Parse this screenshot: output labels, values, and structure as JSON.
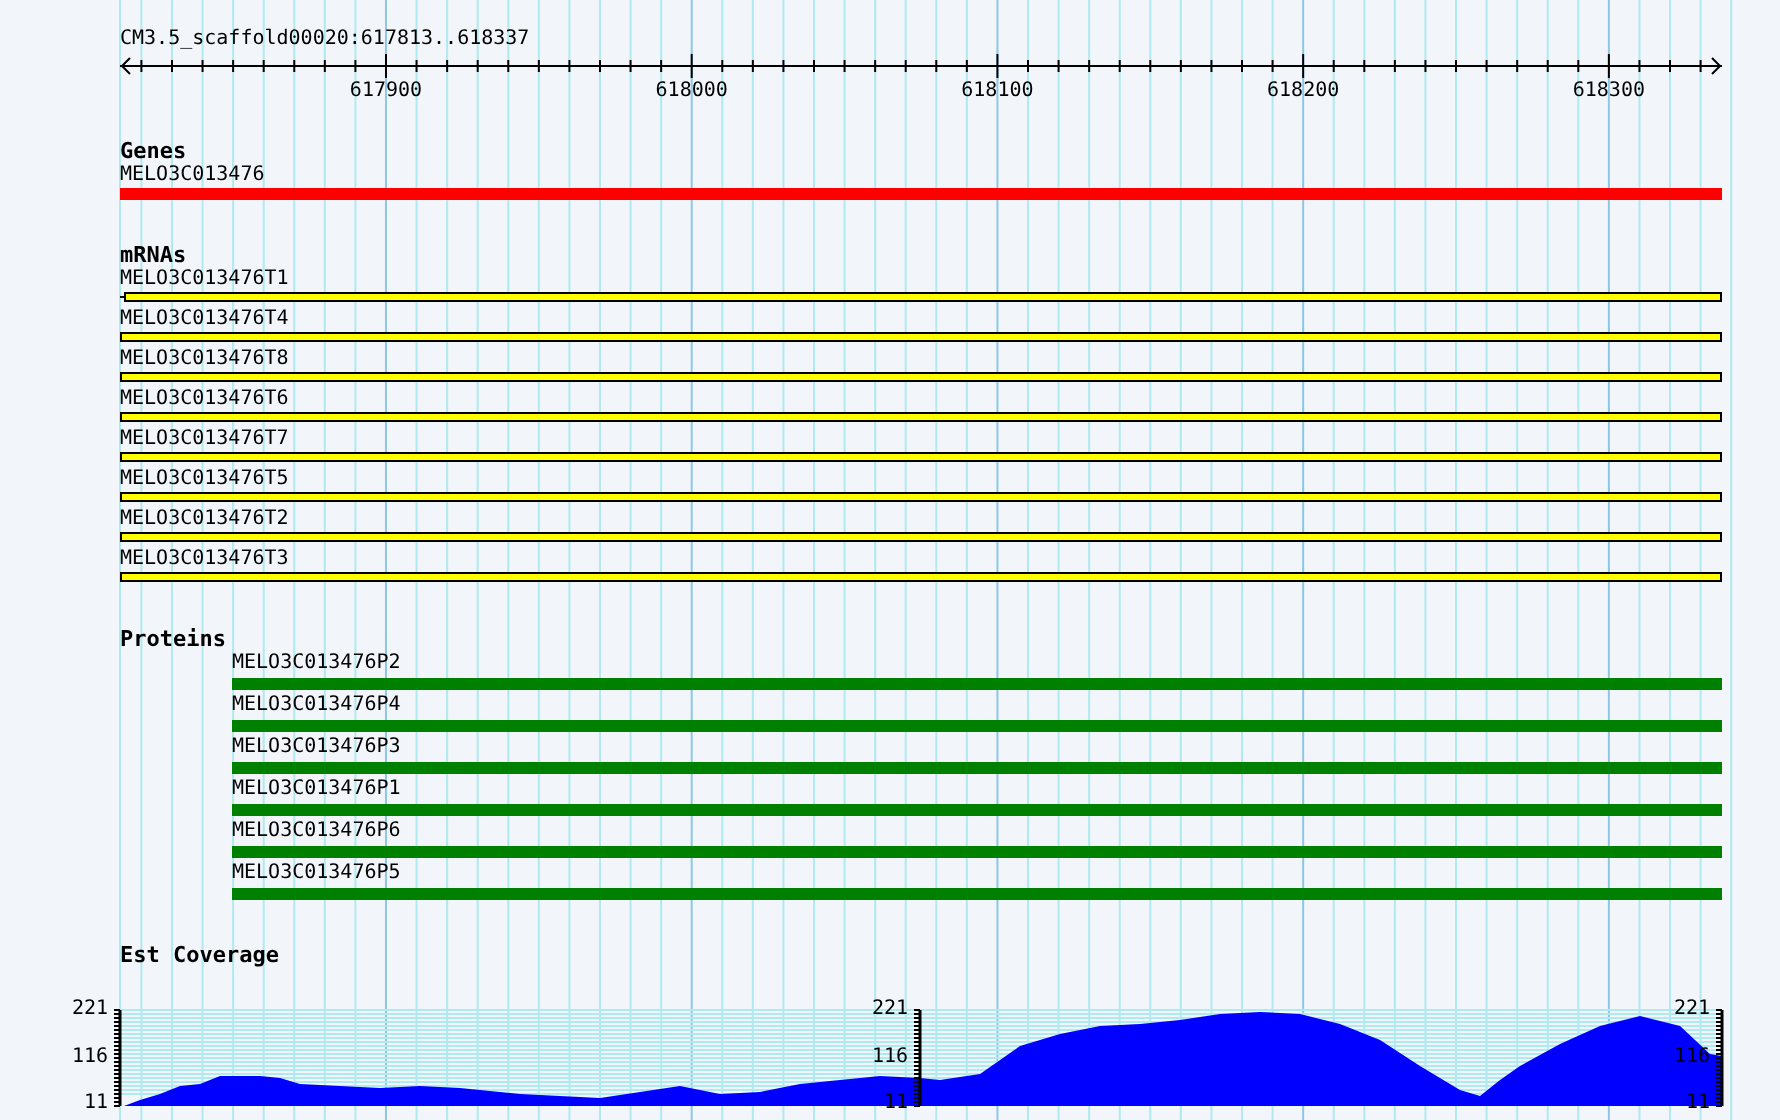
{
  "ruler": {
    "title": "CM3.5_scaffold00020:617813..618337",
    "ticks": [
      "617900",
      "618000",
      "618100",
      "618200",
      "618300"
    ]
  },
  "tracks": [
    {
      "kind": "gene",
      "title": "Genes",
      "features": [
        {
          "label": "MELO3C013476"
        }
      ]
    },
    {
      "kind": "mrna",
      "title": "mRNAs",
      "features": [
        {
          "label": "MELO3C013476T1",
          "kind": "spliced"
        },
        {
          "label": "MELO3C013476T4",
          "kind": "plain"
        },
        {
          "label": "MELO3C013476T8",
          "kind": "plain"
        },
        {
          "label": "MELO3C013476T6",
          "kind": "plain"
        },
        {
          "label": "MELO3C013476T7",
          "kind": "plain"
        },
        {
          "label": "MELO3C013476T5",
          "kind": "plain"
        },
        {
          "label": "MELO3C013476T2",
          "kind": "plain"
        },
        {
          "label": "MELO3C013476T3",
          "kind": "plain"
        }
      ]
    },
    {
      "kind": "protein",
      "title": "Proteins",
      "features": [
        {
          "label": "MELO3C013476P2"
        },
        {
          "label": "MELO3C013476P4"
        },
        {
          "label": "MELO3C013476P3"
        },
        {
          "label": "MELO3C013476P1"
        },
        {
          "label": "MELO3C013476P6"
        },
        {
          "label": "MELO3C013476P5"
        }
      ]
    },
    {
      "kind": "coverage",
      "title": "Est Coverage",
      "axes": [
        {
          "labels": [
            "221",
            "116",
            "11"
          ]
        },
        {
          "labels": [
            "221",
            "116",
            "11"
          ]
        },
        {
          "labels": [
            "221",
            "116",
            "11"
          ]
        }
      ]
    }
  ]
}
